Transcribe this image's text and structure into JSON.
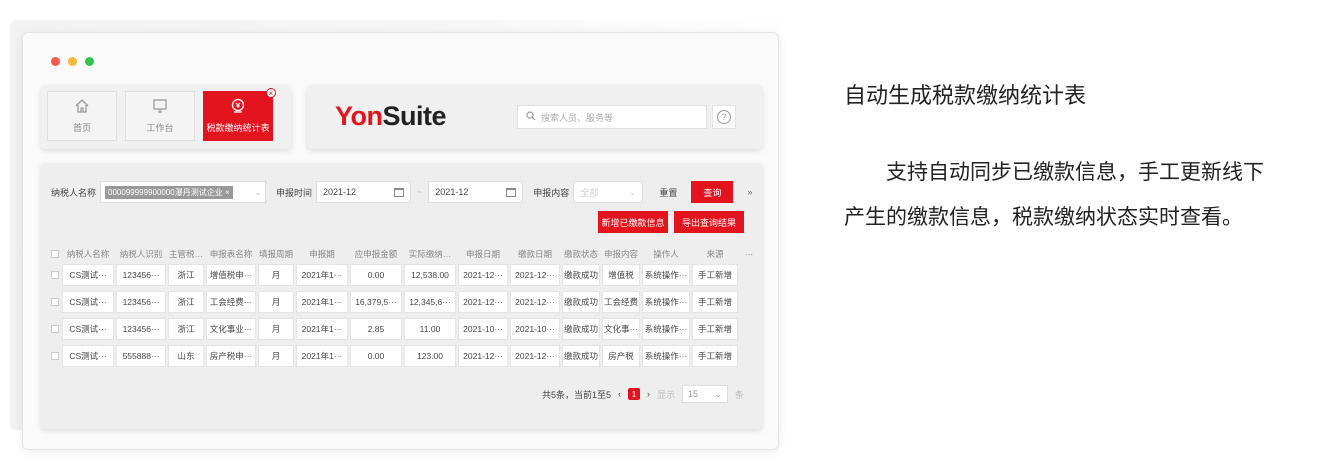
{
  "window": {
    "traffic_lights": [
      "close",
      "minimize",
      "maximize"
    ]
  },
  "tabs": [
    {
      "label": "首页",
      "icon": "home-icon",
      "active": false
    },
    {
      "label": "工作台",
      "icon": "monitor-icon",
      "active": false
    },
    {
      "label": "税款缴纳统计表",
      "icon": "tax-icon",
      "active": true,
      "close": "×"
    }
  ],
  "brand": {
    "yon": "Yon",
    "suite": "Suite"
  },
  "search": {
    "placeholder": "搜索人员、服务等"
  },
  "help": {
    "glyph": "?"
  },
  "filters": {
    "taxpayer_label": "纳税人名称",
    "taxpayer_tag": "000099999900000瀑丹测试企业",
    "tag_close": "×",
    "period_label": "申报时间",
    "period_start": "2021-12",
    "period_sep": "~",
    "period_end": "2021-12",
    "content_label": "申报内容",
    "content_placeholder": "全部",
    "reset": "重置",
    "query": "查询",
    "expand": "»"
  },
  "actions": {
    "add": "新增已缴款信息",
    "export": "导出查询结果"
  },
  "table": {
    "headers": [
      "纳税人名称",
      "纳税人识别",
      "主管税…",
      "申报表名称",
      "填报周期",
      "申报期",
      "应申报金额",
      "实际缴纳…",
      "申报日期",
      "缴款日期",
      "缴款状态",
      "申报内容",
      "操作人",
      "来源"
    ],
    "more": "···",
    "rows": [
      [
        "CS测试···",
        "123456···",
        "浙江",
        "增值税申···",
        "月",
        "2021年1···",
        "0.00",
        "12,538.00",
        "2021-12···",
        "2021-12···",
        "缴款成功",
        "增值税",
        "系统操作···",
        "手工新增"
      ],
      [
        "CS测试···",
        "123456···",
        "浙江",
        "工会经费···",
        "月",
        "2021年1···",
        "16,379,5···",
        "12,345,6···",
        "2021-12···",
        "2021-12···",
        "缴款成功",
        "工会经费",
        "系统操作···",
        "手工新增"
      ],
      [
        "CS测试···",
        "123456···",
        "浙江",
        "文化事业···",
        "月",
        "2021年1···",
        "2.85",
        "11.00",
        "2021-10···",
        "2021-10···",
        "缴款成功",
        "文化事···",
        "系统操作···",
        "手工新增"
      ],
      [
        "CS测试···",
        "555888···",
        "山东",
        "房产税申···",
        "月",
        "2021年1···",
        "0.00",
        "123.00",
        "2021-12···",
        "2021-12···",
        "缴款成功",
        "房产税",
        "系统操作···",
        "手工新增"
      ]
    ]
  },
  "pagination": {
    "summary": "共5条，当前1至5",
    "prev": "‹",
    "current": "1",
    "next": "›",
    "show_label": "显示",
    "page_size": "15",
    "unit": "条"
  },
  "copy": {
    "title": "自动生成税款缴纳统计表",
    "body": "支持自动同步已缴款信息，手工更新线下产生的缴款信息，税款缴纳状态实时查看。"
  },
  "colors": {
    "accent": "#e3141d",
    "text": "#222222"
  }
}
